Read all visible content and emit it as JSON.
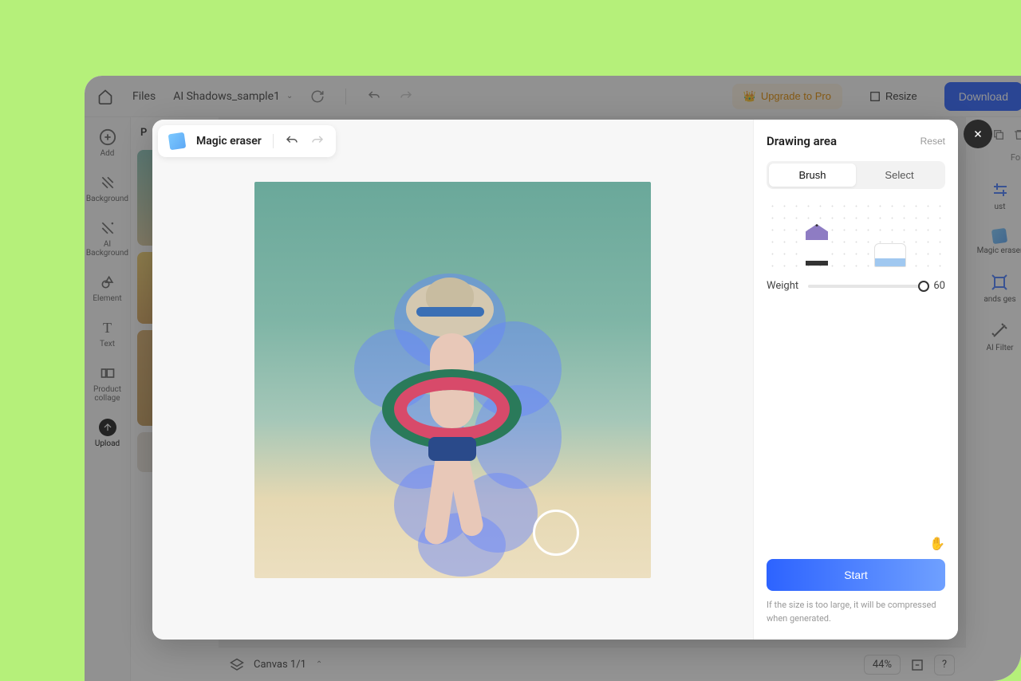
{
  "topbar": {
    "files_label": "Files",
    "document_name": "AI Shadows_sample1",
    "upgrade_label": "Upgrade to Pro",
    "resize_label": "Resize",
    "download_label": "Download"
  },
  "left_rail": {
    "items": [
      {
        "label": "Add"
      },
      {
        "label": "Background"
      },
      {
        "label": "AI Background"
      },
      {
        "label": "Element"
      },
      {
        "label": "Text"
      },
      {
        "label": "Product collage"
      },
      {
        "label": "Upload"
      }
    ]
  },
  "left_panel": {
    "title": "P"
  },
  "right_panel": {
    "fold_label": "Fold",
    "tools": [
      {
        "label": "ust"
      },
      {
        "label": "Magic eraser"
      },
      {
        "label": "ands ges"
      },
      {
        "label": "AI Filter"
      }
    ]
  },
  "bottom_bar": {
    "canvas_label": "Canvas 1/1",
    "zoom_label": "44%"
  },
  "modal": {
    "tool_name": "Magic eraser",
    "drawing_area_title": "Drawing area",
    "reset_label": "Reset",
    "brush_label": "Brush",
    "select_label": "Select",
    "weight_label": "Weight",
    "weight_value": "60",
    "start_label": "Start",
    "hint_text": "If the size is too large, it will be compressed when generated."
  }
}
